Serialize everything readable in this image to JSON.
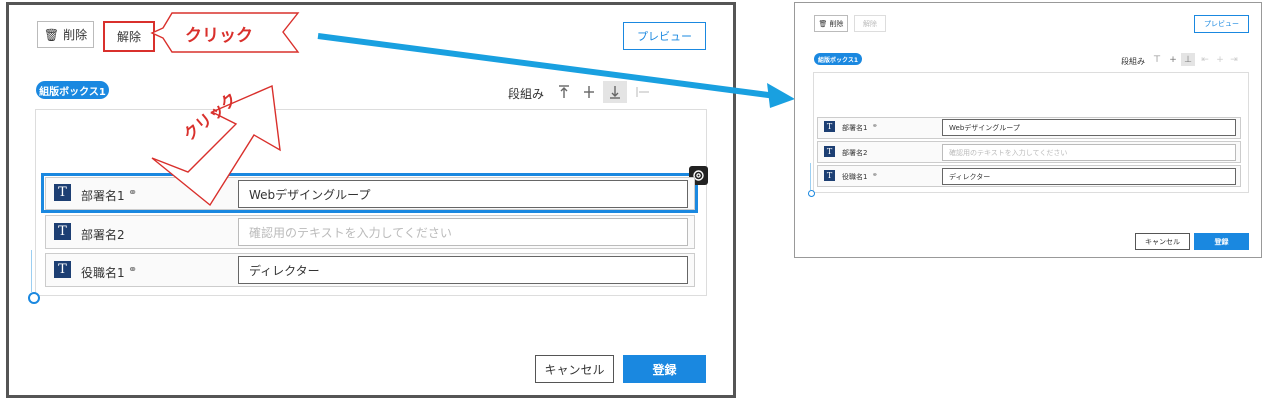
{
  "editor": {
    "delete_label": "削除",
    "release_label": "解除",
    "preview_label": "プレビュー",
    "box_badge": "組版ボックス1",
    "columns_label": "段組み",
    "cancel_label": "キャンセル",
    "register_label": "登録",
    "fields": [
      {
        "label": "部署名1",
        "value": "Webデザイングループ",
        "placeholder": "",
        "linked": true
      },
      {
        "label": "部署名2",
        "value": "",
        "placeholder": "確認用のテキストを入力してください",
        "linked": false
      },
      {
        "label": "役職名1",
        "value": "ディレクター",
        "placeholder": "",
        "linked": true
      }
    ]
  },
  "annotations": {
    "click_label_1": "クリック",
    "click_label_2": "クリック",
    "highlight_color": "#d9302c",
    "arrow_color": "#19a0e0"
  },
  "icons": {
    "trash": "trash-icon",
    "link": "link-icon",
    "gear": "gear-icon",
    "text_type": "text-type-icon"
  }
}
